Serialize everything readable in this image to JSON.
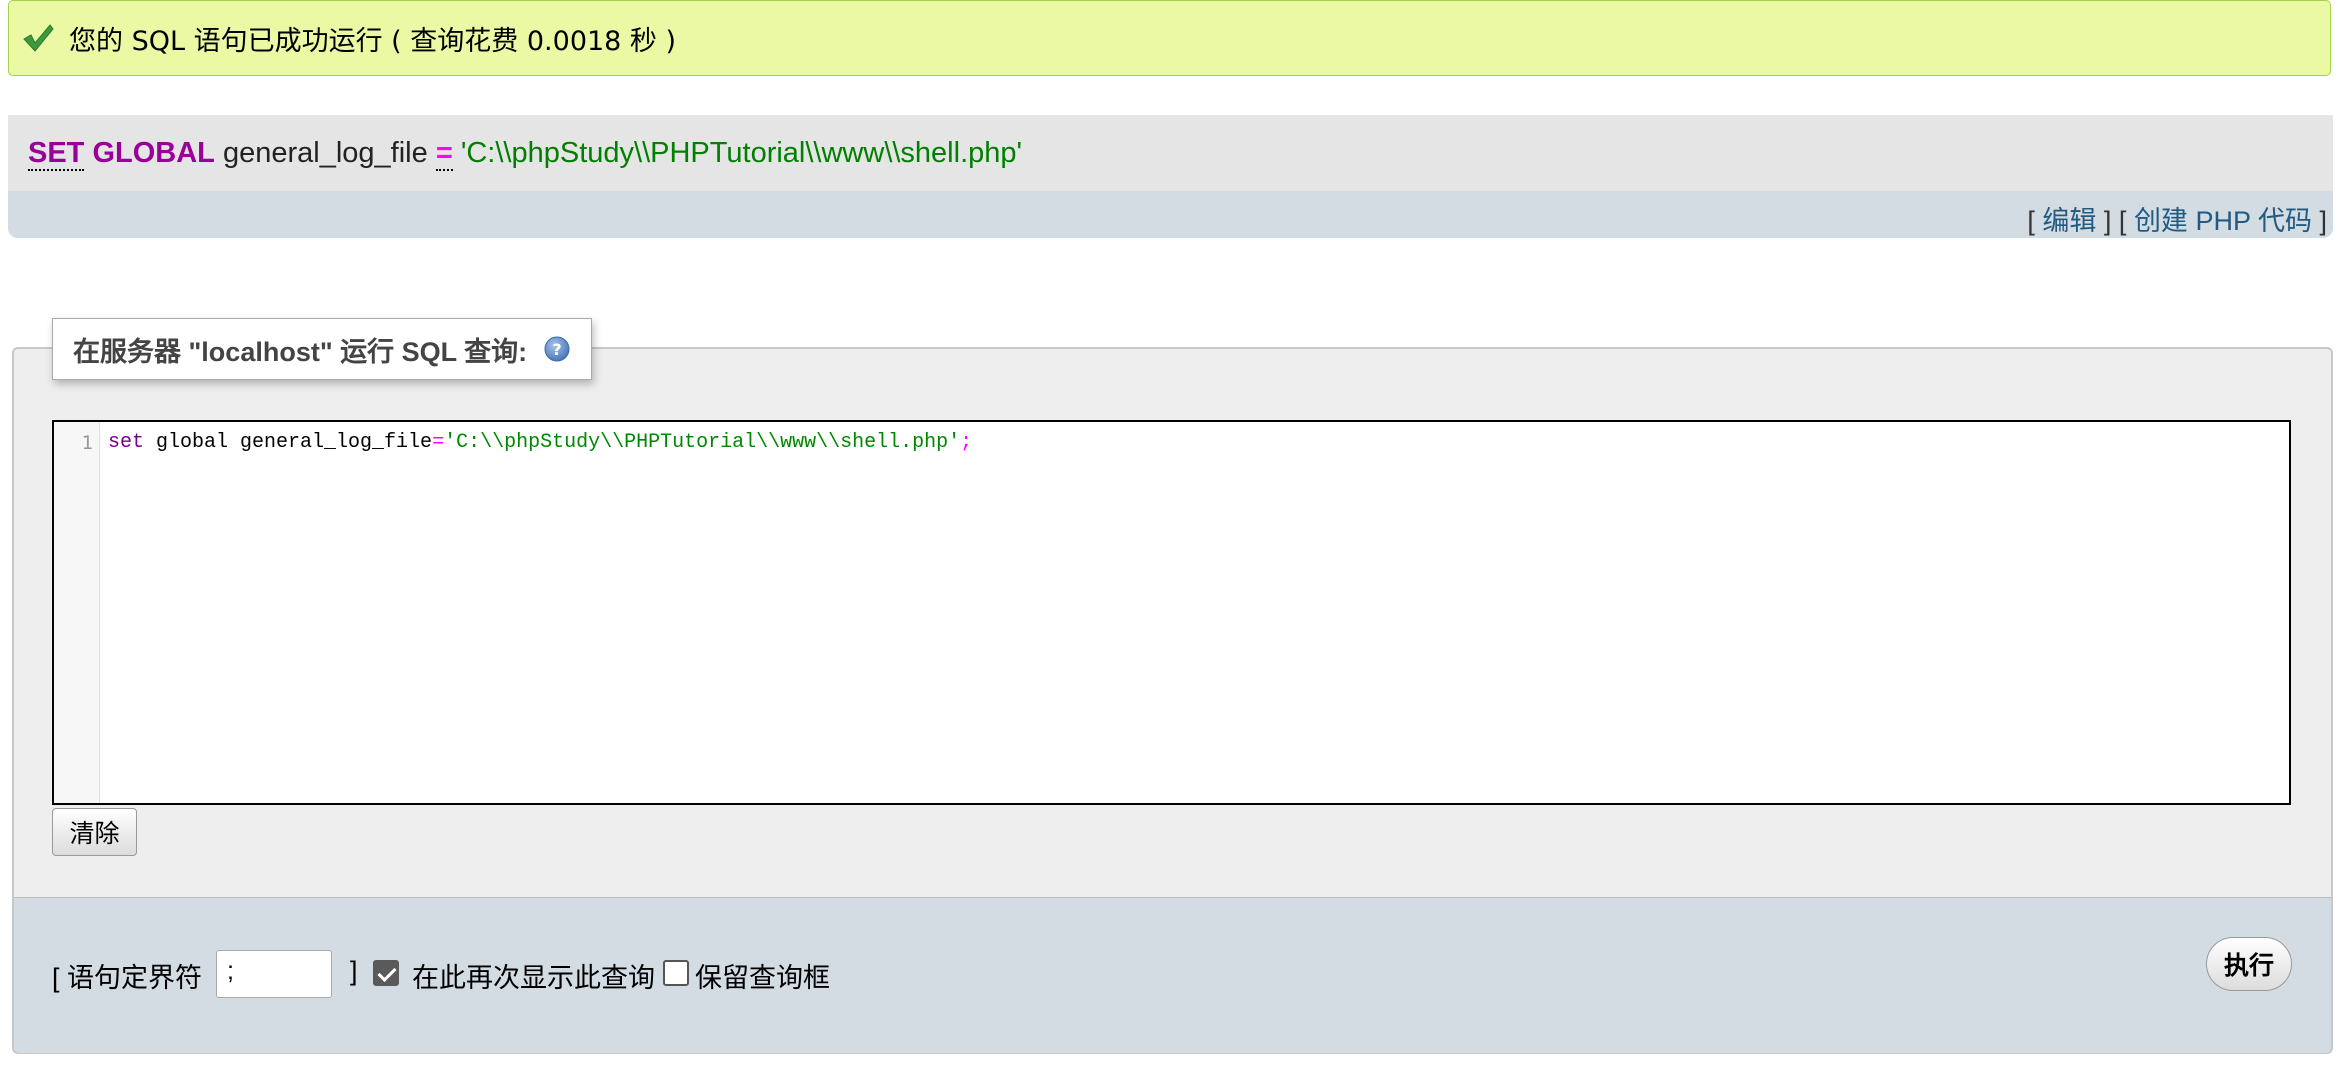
{
  "success_message": "您的 SQL 语句已成功运行 ( 查询花费 0.0018 秒 )",
  "executed_sql": {
    "keyword_set": "SET",
    "keyword_global": "GLOBAL",
    "variable": "general_log_file",
    "operator": "=",
    "value": "'C:\\\\phpStudy\\\\PHPTutorial\\\\www\\\\shell.php'"
  },
  "sql_tools": {
    "open_bracket": "[",
    "edit_link": "编辑",
    "separator": "] [",
    "create_php_link": "创建 PHP 代码",
    "close_bracket": "]"
  },
  "query_panel": {
    "legend": "在服务器 \"localhost\" 运行 SQL 查询:",
    "editor": {
      "line_number": "1",
      "kw": "set",
      "plain": " global general_log_file",
      "op": "=",
      "str": "'C:\\\\phpStudy\\\\PHPTutorial\\\\www\\\\shell.php'",
      "end": ";"
    },
    "clear_button": "清除"
  },
  "footer": {
    "bracket_open_label": "[ 语句定界符",
    "delimiter_value": ";",
    "bracket_close": "]",
    "show_query_again_label": "在此再次显示此查询",
    "show_query_again_checked": true,
    "keep_query_box_label": "保留查询框",
    "keep_query_box_checked": false,
    "go_button": "执行"
  },
  "colors": {
    "success_bg": "#ebf8a4",
    "success_border": "#a2d246",
    "keyword": "#990099",
    "string": "#008000",
    "link": "#235a81",
    "toolbar_bg": "#d3dce3"
  },
  "icons": {
    "success": "check-icon",
    "help": "help-icon"
  }
}
